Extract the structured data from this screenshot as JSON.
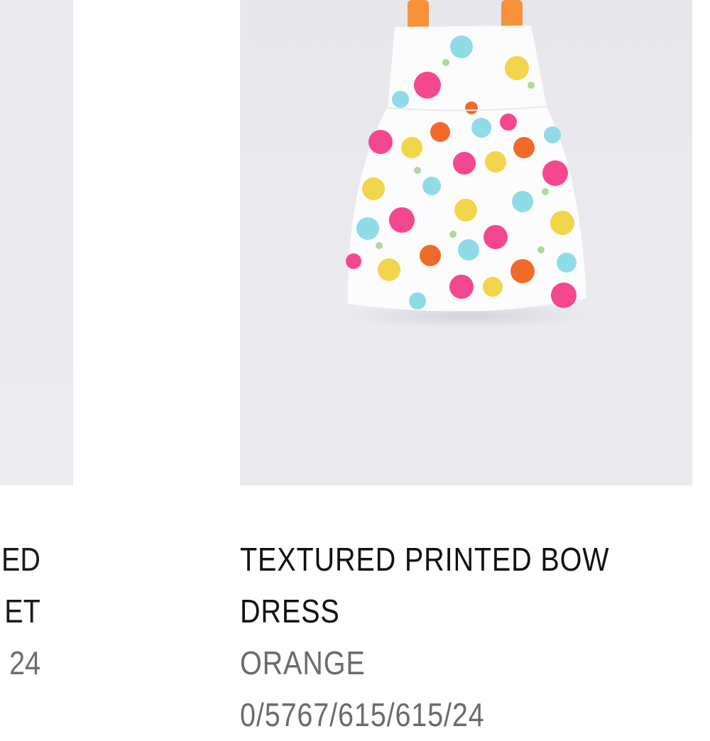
{
  "left_card": {
    "name_line_1": "ED",
    "name_line_2": "ET",
    "price_line": "24"
  },
  "right_card": {
    "name": "TEXTURED PRINTED BOW DRESS",
    "color": "ORANGE",
    "reference": "0/5767/615/615/24",
    "image_icon": "floral-dress-image",
    "colors": {
      "strap": "#f7923a",
      "pink": "#f5478f",
      "yellow": "#f2d54a",
      "orange": "#f26a2a",
      "blue": "#8fdbe8",
      "leaf": "#9ad08a"
    }
  }
}
